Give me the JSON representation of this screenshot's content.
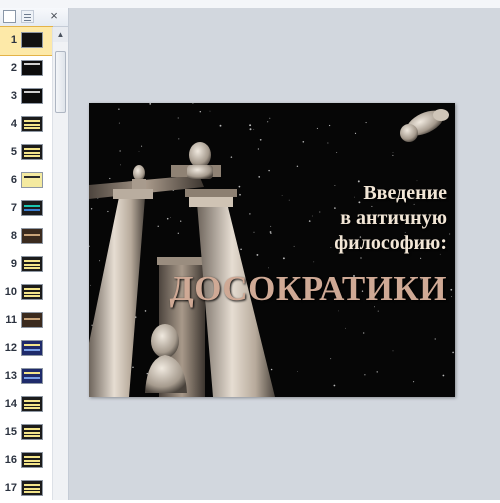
{
  "thumbnail_panel": {
    "close_label": "×",
    "slides": [
      {
        "number": "1",
        "selected": true,
        "style": "dark-statues"
      },
      {
        "number": "2",
        "selected": false,
        "style": "dark"
      },
      {
        "number": "3",
        "selected": false,
        "style": "dark"
      },
      {
        "number": "4",
        "selected": false,
        "style": "yellow-text"
      },
      {
        "number": "5",
        "selected": false,
        "style": "yellow-text"
      },
      {
        "number": "6",
        "selected": false,
        "style": "yellow-image"
      },
      {
        "number": "7",
        "selected": false,
        "style": "green-image"
      },
      {
        "number": "8",
        "selected": false,
        "style": "brown-photo"
      },
      {
        "number": "9",
        "selected": false,
        "style": "yellow-text"
      },
      {
        "number": "10",
        "selected": false,
        "style": "yellow-text"
      },
      {
        "number": "11",
        "selected": false,
        "style": "brown-photo"
      },
      {
        "number": "12",
        "selected": false,
        "style": "blue-image"
      },
      {
        "number": "13",
        "selected": false,
        "style": "blue-image"
      },
      {
        "number": "14",
        "selected": false,
        "style": "yellow-text"
      },
      {
        "number": "15",
        "selected": false,
        "style": "yellow-text"
      },
      {
        "number": "16",
        "selected": false,
        "style": "yellow-text"
      },
      {
        "number": "17",
        "selected": false,
        "style": "yellow-text"
      }
    ]
  },
  "slide": {
    "title_lines": [
      "Введение",
      "в античную",
      "философию:"
    ],
    "subtitle": "ДОСОКРАТИКИ"
  },
  "colors": {
    "slide_background": "#060606",
    "title_color": "#f2e6d6",
    "subtitle_color": "#cfa995",
    "selected_row": "#fde9a8",
    "stage_background": "#d2d7de"
  }
}
